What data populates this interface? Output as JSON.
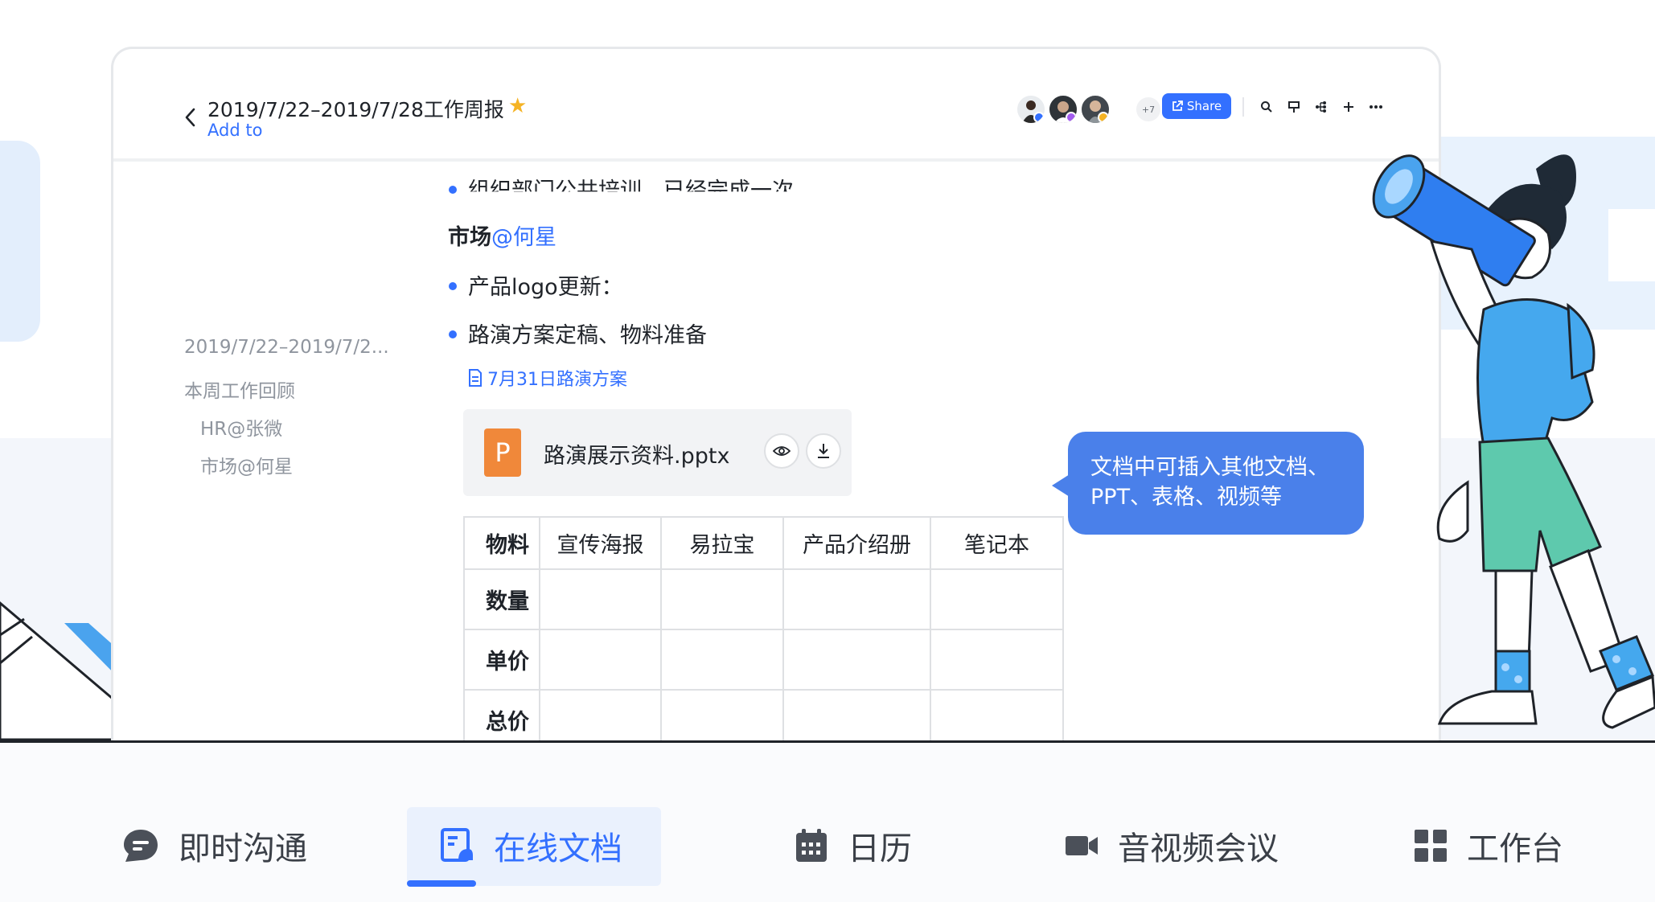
{
  "header": {
    "title": "2019/7/22–2019/7/28工作周报",
    "add_to": "Add to",
    "more_collaborators": "+7",
    "share_label": "Share"
  },
  "outline": {
    "items": [
      "2019/7/22–2019/7/2...",
      "本周工作回顾",
      "HR@张微",
      "市场@何星"
    ]
  },
  "content": {
    "partial_line": "组织部门公共培训，已经完成一次",
    "section_heading": "市场",
    "section_mention": "@何星",
    "bullets": [
      "产品logo更新：",
      "路演方案定稿、物料准备"
    ],
    "linked_doc": "7月31日路演方案",
    "attachment": {
      "name": "路演展示资料.pptx",
      "icon_letter": "P"
    },
    "table": {
      "header": [
        "物料",
        "宣传海报",
        "易拉宝",
        "产品介绍册",
        "笔记本"
      ],
      "rows": [
        [
          "数量",
          "",
          "",
          "",
          ""
        ],
        [
          "单价",
          "",
          "",
          "",
          ""
        ],
        [
          "总价",
          "",
          "",
          "",
          ""
        ]
      ]
    }
  },
  "tooltip": {
    "line1": "文档中可插入其他文档、",
    "line2": "PPT、表格、视频等"
  },
  "nav": {
    "items": [
      {
        "label": "即时沟通",
        "icon": "chat-bubble-icon"
      },
      {
        "label": "在线文档",
        "icon": "document-icon"
      },
      {
        "label": "日历",
        "icon": "calendar-icon"
      },
      {
        "label": "音视频会议",
        "icon": "video-camera-icon"
      },
      {
        "label": "工作台",
        "icon": "grid-apps-icon"
      }
    ],
    "active_index": 1
  },
  "colors": {
    "accent": "#3370ff",
    "star": "#f5b324",
    "bubble": "#4a80ea",
    "pptx": "#f0883a"
  }
}
